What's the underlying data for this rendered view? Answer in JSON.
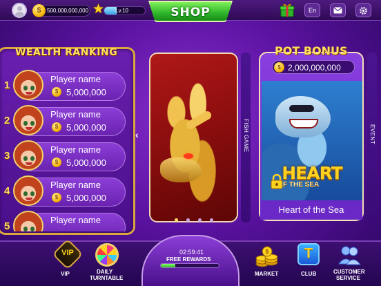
{
  "topbar": {
    "coins": "500,000,000,000",
    "level": "Lv.10",
    "level_progress": 0.3,
    "shop_label": "SHOP",
    "language": "En"
  },
  "ranking": {
    "title": "WEALTH RANKING",
    "players": [
      {
        "rank": "1",
        "name": "Player name",
        "amount": "5,000,000"
      },
      {
        "rank": "2",
        "name": "Player name",
        "amount": "5,000,000"
      },
      {
        "rank": "3",
        "name": "Player name",
        "amount": "5,000,000"
      },
      {
        "rank": "4",
        "name": "Player name",
        "amount": "5,000,000"
      },
      {
        "rank": "5",
        "name": "Player name",
        "amount": ""
      }
    ]
  },
  "fish_game": {
    "side_label": "FISH GAME",
    "page_count": 4,
    "active_page": 0
  },
  "event": {
    "side_label": "EVENT",
    "pot_title": "POT BONUS",
    "pot_amount": "2,000,000,000",
    "logo_main": "HEART",
    "logo_sub": "F THE SEA",
    "caption": "Heart of the Sea"
  },
  "bottom": {
    "vip_badge": "VIP",
    "vip_label": "VIP",
    "turntable_label_1": "DAILY",
    "turntable_label_2": "TURNTABLE",
    "timer": "02:59:41",
    "free_rewards": "FREE REWARDS",
    "reward_progress": 0.25,
    "market_label": "MARKET",
    "club_badge": "T",
    "club_label": "CLUB",
    "cs_label_1": "CUSTOMER",
    "cs_label_2": "SERVICE"
  },
  "icons": {
    "avatar": "user-avatar-icon",
    "coin": "coin-icon",
    "star": "star-icon",
    "gift": "gift-icon",
    "mail": "mail-icon",
    "settings": "gear-icon"
  },
  "colors": {
    "accent_gold": "#ffe060",
    "shop_green": "#2fb52a",
    "panel_purple": "#6a22b0"
  }
}
